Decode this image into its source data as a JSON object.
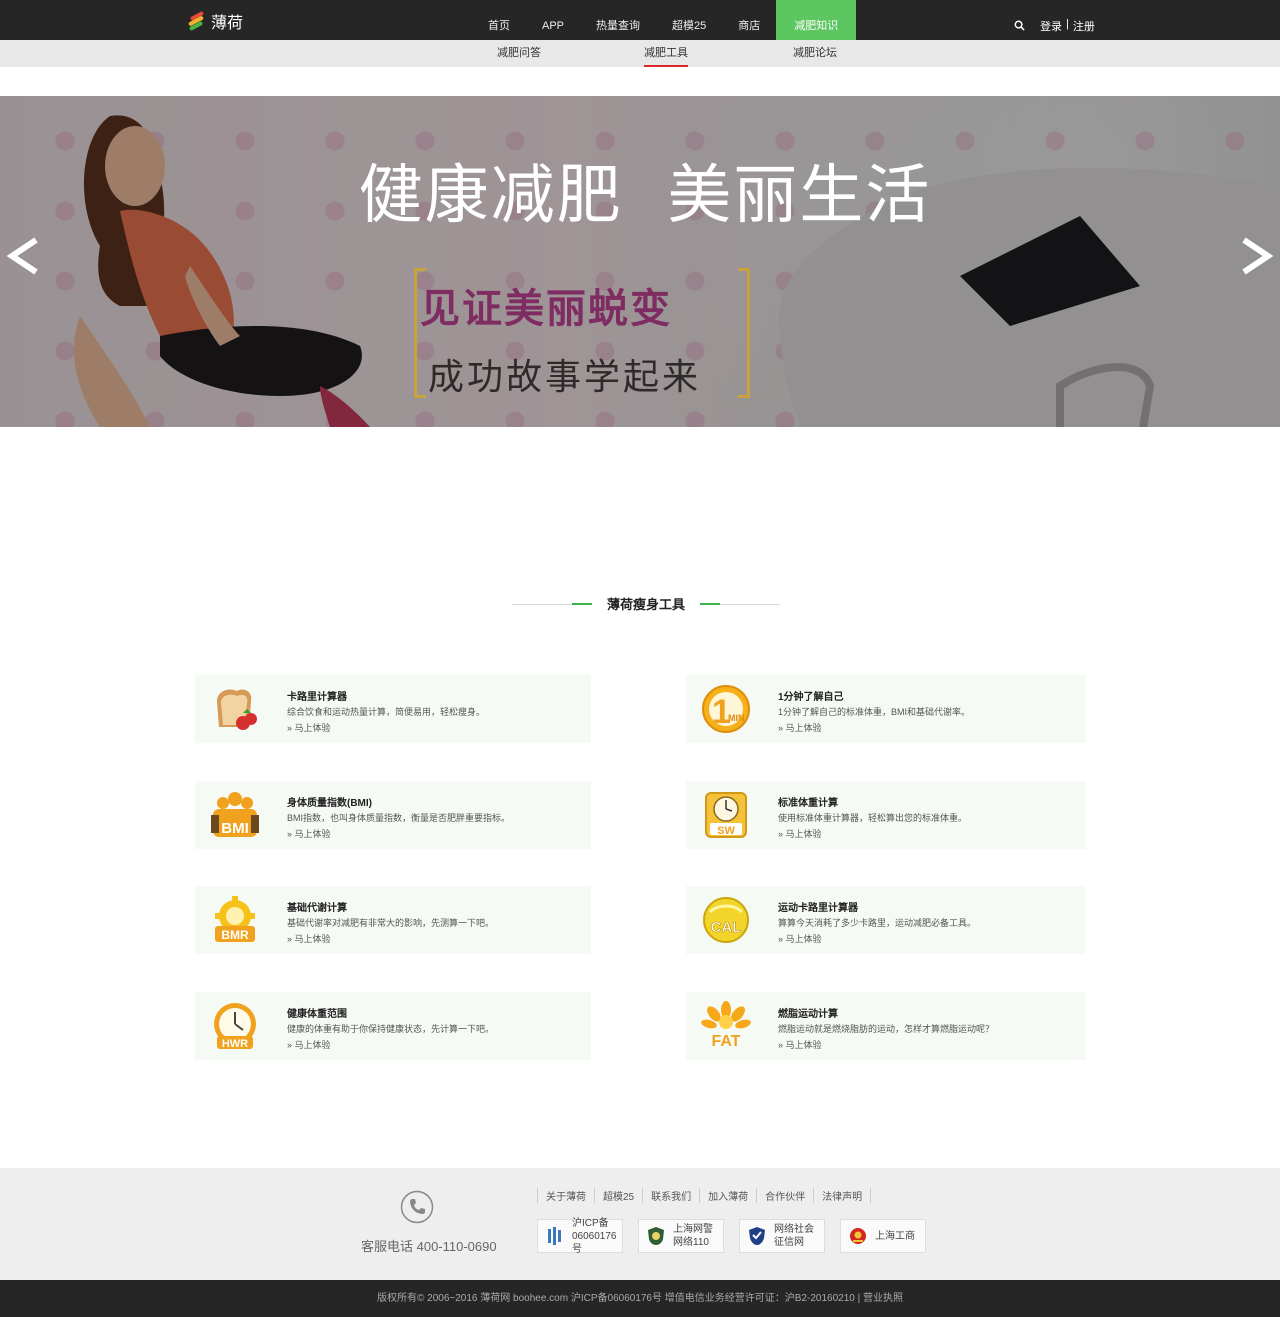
{
  "brand": {
    "name": "薄荷"
  },
  "nav": {
    "items": [
      {
        "label": "首页"
      },
      {
        "label": "APP"
      },
      {
        "label": "热量查询"
      },
      {
        "label": "超模25"
      },
      {
        "label": "商店"
      },
      {
        "label": "减肥知识"
      }
    ],
    "active": "减肥知识",
    "login": "登录",
    "separator": "|",
    "register": "注册"
  },
  "subnav": {
    "items": [
      {
        "label": "减肥问答"
      },
      {
        "label": "减肥工具"
      },
      {
        "label": "减肥论坛"
      }
    ],
    "active": "减肥工具"
  },
  "banner": {
    "headline": "健康减肥  美丽生活",
    "subline1": "见证美丽蜕变",
    "subline2": "成功故事学起来",
    "prev_glyph": "<",
    "next_glyph": ">"
  },
  "section": {
    "title": "薄荷瘦身工具"
  },
  "tools": [
    {
      "title": "卡路里计算器",
      "desc": "综合饮食和运动热量计算，简便易用，轻松瘦身。",
      "link": "» 马上体验",
      "icon": "bread-strawberry-icon"
    },
    {
      "title": "1分钟了解自己",
      "desc": "1分钟了解自己的标准体重，BMI和基础代谢率。",
      "link": "» 马上体验",
      "icon": "one-min-icon",
      "icon_text": "1",
      "icon_sub": "MIN"
    },
    {
      "title": "身体质量指数(BMI)",
      "desc": "BMI指数，也叫身体质量指数，衡量是否肥胖重要指标。",
      "link": "» 马上体验",
      "icon": "bmi-icon",
      "icon_text": "BMI"
    },
    {
      "title": "标准体重计算",
      "desc": "使用标准体重计算器，轻松算出您的标准体重。",
      "link": "» 马上体验",
      "icon": "sw-scale-icon",
      "icon_text": "SW"
    },
    {
      "title": "基础代谢计算",
      "desc": "基础代谢率对减肥有非常大的影响，先测算一下吧。",
      "link": "» 马上体验",
      "icon": "bmr-gear-icon",
      "icon_text": "BMR"
    },
    {
      "title": "运动卡路里计算器",
      "desc": "算算今天消耗了多少卡路里，运动减肥必备工具。",
      "link": "» 马上体验",
      "icon": "cal-ball-icon",
      "icon_text": "CAL"
    },
    {
      "title": "健康体重范围",
      "desc": "健康的体重有助于你保持健康状态，先计算一下吧。",
      "link": "» 马上体验",
      "icon": "hwr-clock-icon",
      "icon_text": "HWR"
    },
    {
      "title": "燃脂运动计算",
      "desc": "燃脂运动就是燃烧脂肪的运动，怎样才算燃脂运动呢？",
      "link": "» 马上体验",
      "icon": "fat-flower-icon",
      "icon_text": "FAT"
    }
  ],
  "footer": {
    "hotline": "客服电话 400-110-0690",
    "links": [
      "关于薄荷",
      "超模25",
      "联系我们",
      "加入薄荷",
      "合作伙伴",
      "法律声明"
    ],
    "badges": [
      {
        "line1": "沪ICP备",
        "line2": "06060176号"
      },
      {
        "line1": "上海网警",
        "line2": "网络110"
      },
      {
        "line1": "网络社会",
        "line2": "征信网"
      },
      {
        "line1": "上海工商",
        "line2": ""
      }
    ],
    "copyright": "版权所有© 2006~2016 薄荷网 boohee.com 沪ICP备06060176号 增值电信业务经营许可证：沪B2-20160210 | 营业执照"
  },
  "colors": {
    "topbar": "#262626",
    "accent_green": "#5cc661",
    "subnav_active": "#d9262b",
    "card_bg": "#f6faf4",
    "icon_orange": "#f0a21e"
  }
}
